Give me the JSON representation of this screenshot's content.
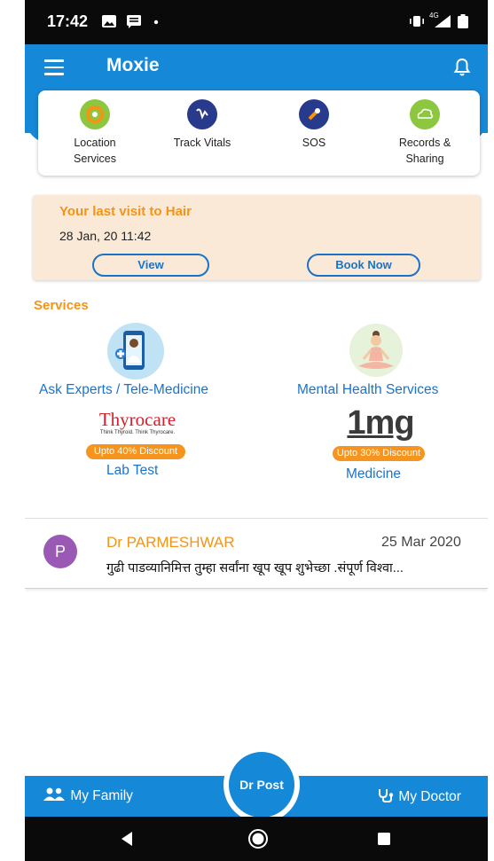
{
  "status_bar": {
    "time": "17:42",
    "network": "4G"
  },
  "header": {
    "title": "Moxie"
  },
  "quick_actions": [
    {
      "label": "Location Services",
      "line1": "Location",
      "line2": "Services",
      "icon": "location-icon",
      "color": "#8dc63f"
    },
    {
      "label": "Track Vitals",
      "line1": "Track Vitals",
      "line2": "",
      "icon": "vitals-icon",
      "color": "#283a8c"
    },
    {
      "label": "SOS",
      "line1": "SOS",
      "line2": "",
      "icon": "sos-icon",
      "color": "#283a8c"
    },
    {
      "label": "Records & Sharing",
      "line1": "Records &",
      "line2": "Sharing",
      "icon": "cloud-icon",
      "color": "#8dc63f"
    }
  ],
  "last_visit": {
    "title": "Your last visit to Hair",
    "date": "28 Jan, 20 11:42",
    "view_label": "View",
    "book_label": "Book Now"
  },
  "services": {
    "title": "Services",
    "ask_experts": "Ask Experts / Tele-Medicine",
    "mental_health": "Mental Health Services",
    "thyrocare_logo": "Thyrocare",
    "thyrocare_tagline": "Think Thyroid. Think Thyrocare.",
    "lab_discount": "Upto 40% Discount",
    "lab_test": "Lab Test",
    "onemg_logo": "1mg",
    "medicine_discount": "Upto 30% Discount",
    "medicine": "Medicine"
  },
  "post": {
    "avatar_letter": "P",
    "author": "Dr PARMESHWAR",
    "date": "25 Mar 2020",
    "text": "गुढी पाडव्यानिमित्त तुम्हा सर्वांना खूप खूप शुभेच्छा .संपूर्ण विश्वा..."
  },
  "bottom_nav": {
    "family": "My Family",
    "dr_post": "Dr Post",
    "doctor": "My Doctor"
  },
  "colors": {
    "primary": "#1688d8",
    "accent_orange": "#f39416",
    "link_blue": "#1b73c9",
    "discount_orange": "#f7941d"
  }
}
